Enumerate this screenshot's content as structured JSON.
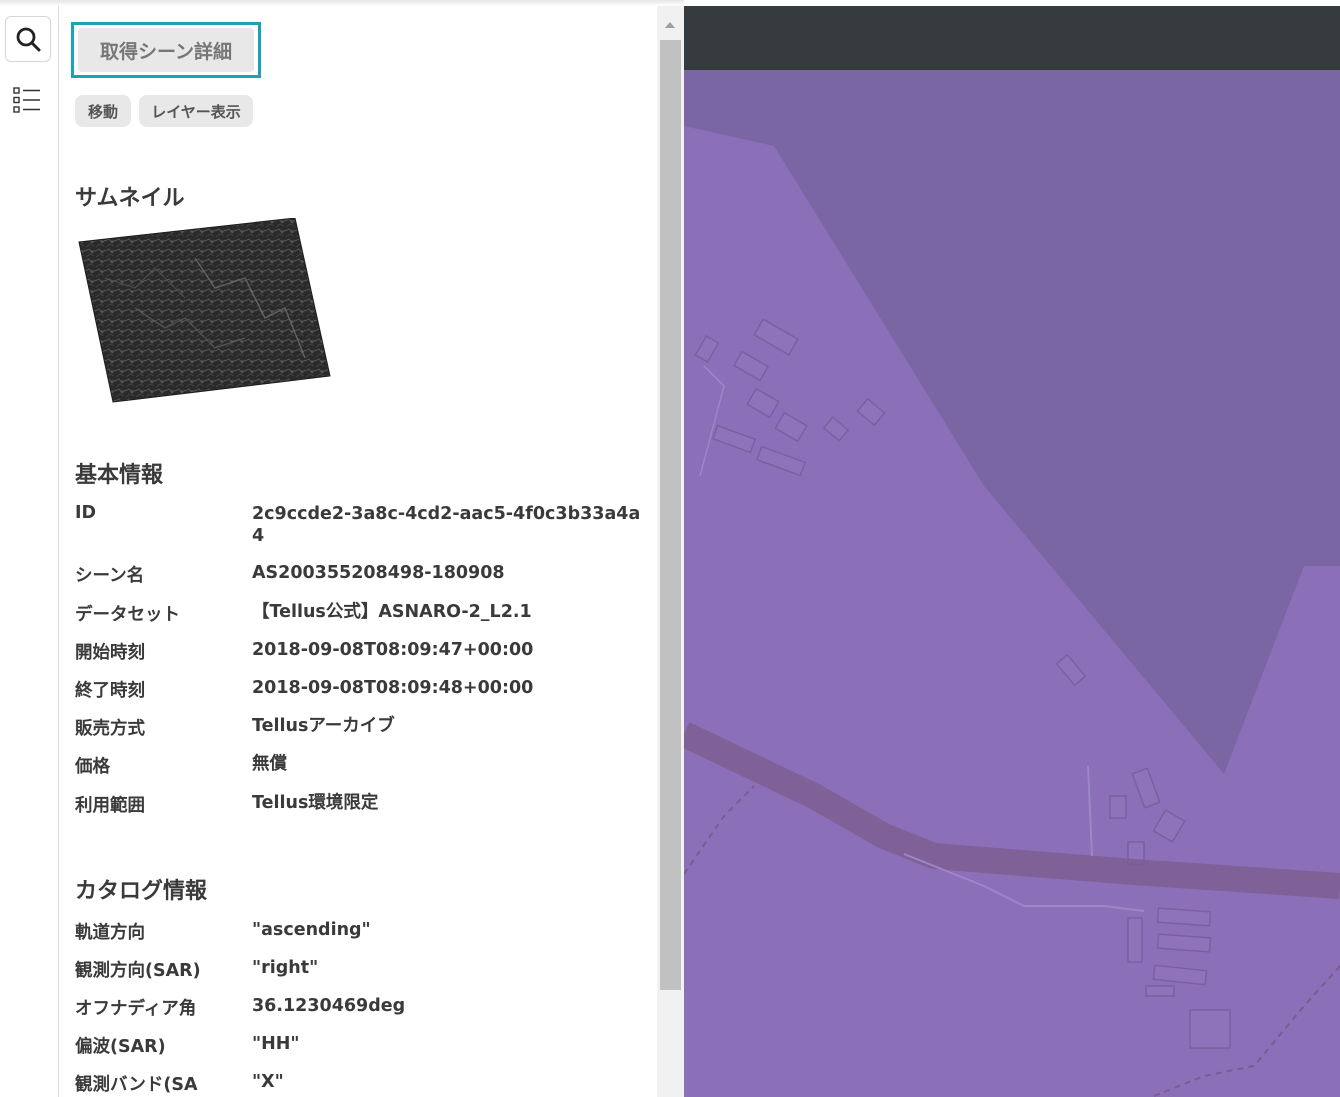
{
  "sidebar": {
    "search_icon": "search-icon",
    "list_icon": "list-icon"
  },
  "panel": {
    "title": "取得シーン詳細",
    "buttons": {
      "move": "移動",
      "layer": "レイヤー表示"
    },
    "thumbnail_heading": "サムネイル",
    "basic": {
      "heading": "基本情報",
      "rows": [
        {
          "key": "ID",
          "value": "2c9ccde2-3a8c-4cd2-aac5-4f0c3b33a4a4"
        },
        {
          "key": "シーン名",
          "value": "AS200355208498-180908"
        },
        {
          "key": "データセット",
          "value": "【Tellus公式】ASNARO-2_L2.1"
        },
        {
          "key": "開始時刻",
          "value": "2018-09-08T08:09:47+00:00"
        },
        {
          "key": "終了時刻",
          "value": "2018-09-08T08:09:48+00:00"
        },
        {
          "key": "販売方式",
          "value": "Tellusアーカイブ"
        },
        {
          "key": "価格",
          "value": "無償"
        },
        {
          "key": "利用範囲",
          "value": "Tellus環境限定"
        }
      ]
    },
    "catalog": {
      "heading": "カタログ情報",
      "rows": [
        {
          "key": "軌道方向",
          "value": "\"ascending\""
        },
        {
          "key": "観測方向(SAR)",
          "value": "\"right\""
        },
        {
          "key": "オフナディア角",
          "value": "36.1230469deg"
        },
        {
          "key": "偏波(SAR)",
          "value": "\"HH\""
        },
        {
          "key": "観測バンド(SA",
          "value": "\"X\""
        }
      ]
    }
  },
  "colors": {
    "accent": "#1aa3b5",
    "map_fill": "#8b6fb9",
    "map_dark": "#7a66a3",
    "map_header": "#363b40",
    "road": "#8c6aa6"
  }
}
